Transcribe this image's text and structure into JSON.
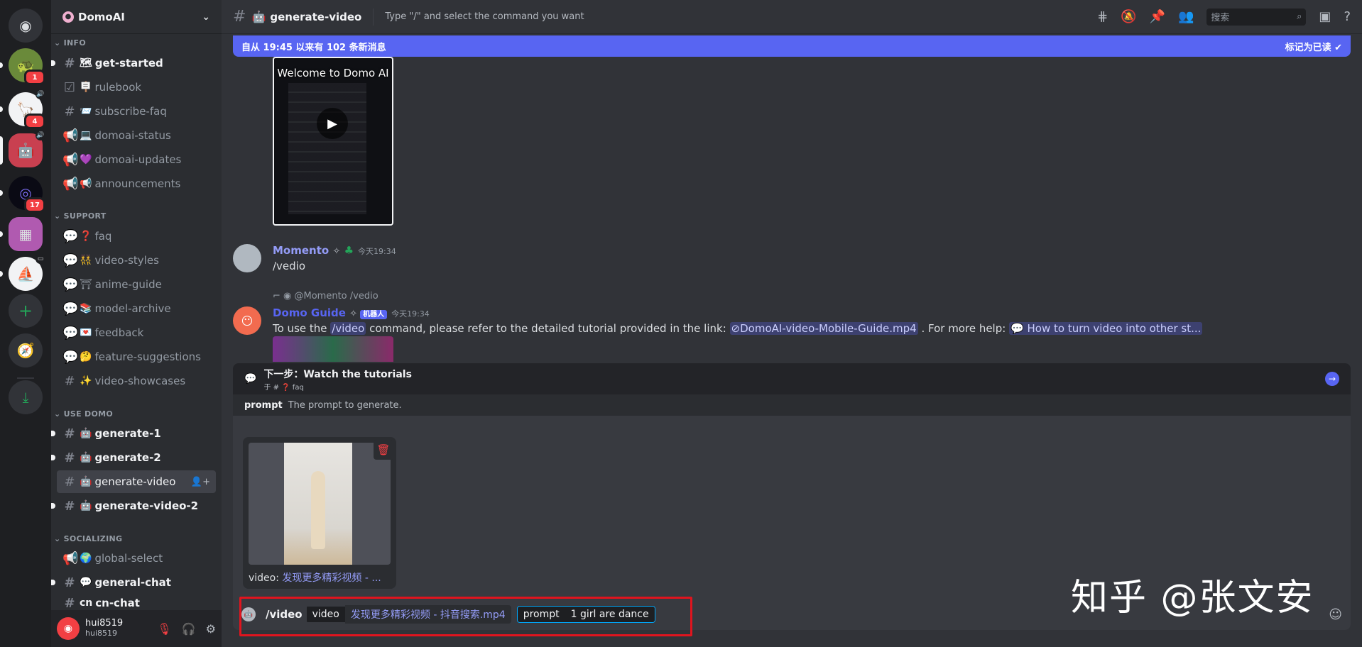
{
  "server_rail": {
    "badges": [
      "1",
      "4",
      "17"
    ]
  },
  "guild": {
    "name": "DomoAI"
  },
  "categories": {
    "info": "INFO",
    "support": "SUPPORT",
    "use_domo": "USE DOMO",
    "socializing": "SOCIALIZING"
  },
  "channels": {
    "info": [
      {
        "emoji": "🗺",
        "name": "get-started"
      },
      {
        "emoji": "🪧",
        "name": "rulebook"
      },
      {
        "emoji": "📨",
        "name": "subscribe-faq"
      },
      {
        "emoji": "💻",
        "name": "domoai-status"
      },
      {
        "emoji": "💜",
        "name": "domoai-updates"
      },
      {
        "emoji": "📢",
        "name": "announcements"
      }
    ],
    "support": [
      {
        "emoji": "❓",
        "name": "faq"
      },
      {
        "emoji": "👯",
        "name": "video-styles"
      },
      {
        "emoji": "⛩",
        "name": "anime-guide"
      },
      {
        "emoji": "📚",
        "name": "model-archive"
      },
      {
        "emoji": "💌",
        "name": "feedback"
      },
      {
        "emoji": "🤔",
        "name": "feature-suggestions"
      },
      {
        "emoji": "✨",
        "name": "video-showcases"
      }
    ],
    "use_domo": [
      {
        "emoji": "🤖",
        "name": "generate-1"
      },
      {
        "emoji": "🤖",
        "name": "generate-2"
      },
      {
        "emoji": "🤖",
        "name": "generate-video"
      },
      {
        "emoji": "🤖",
        "name": "generate-video-2"
      }
    ],
    "socializing": [
      {
        "emoji": "🌍",
        "name": "global-select"
      },
      {
        "emoji": "💬",
        "name": "general-chat"
      },
      {
        "emoji": "cn",
        "name": "cn-chat"
      }
    ]
  },
  "user": {
    "name": "hui8519",
    "tag": "hui8519"
  },
  "header": {
    "channel": "generate-video",
    "topic": "Type \"/\" and select the command you want",
    "search_placeholder": "搜索"
  },
  "new_messages_bar": {
    "text": "自从 19:45 以来有 102 条新消息",
    "mark_read": "标记为已读"
  },
  "video_embed": {
    "title": "Welcome to Domo AI"
  },
  "messages": [
    {
      "author": "Momento",
      "time": "今天19:34",
      "text": "/vedio",
      "author_color": "#949cf7"
    },
    {
      "author": "Domo Guide",
      "bot_tag": "机器人",
      "time": "今天19:34",
      "reply_user": "@Momento",
      "reply_text": "/vedio",
      "text_before": "To use the",
      "cmd": "/video",
      "text_mid": "command, please refer to the detailed tutorial provided in the link:",
      "link1": "DomoAI-video-Mobile-Guide.mp4",
      "text_after": ". For more help:",
      "link2": "How to turn video into other st...",
      "author_color": "#5865f2"
    }
  ],
  "next_step": {
    "title": "下一步：Watch the tutorials",
    "sub": "于 # ❓ faq"
  },
  "option_hint": {
    "name": "prompt",
    "desc": "The prompt to generate."
  },
  "attachment": {
    "label": "video:",
    "filename": "发现更多精彩视频 - ..."
  },
  "command": {
    "name": "/video",
    "opt1_name": "video",
    "opt1_value": "发现更多精彩视频 - 抖音搜索.mp4",
    "opt2_name": "prompt",
    "opt2_value": "1 girl are dance"
  },
  "watermark": "知乎 @张文安"
}
